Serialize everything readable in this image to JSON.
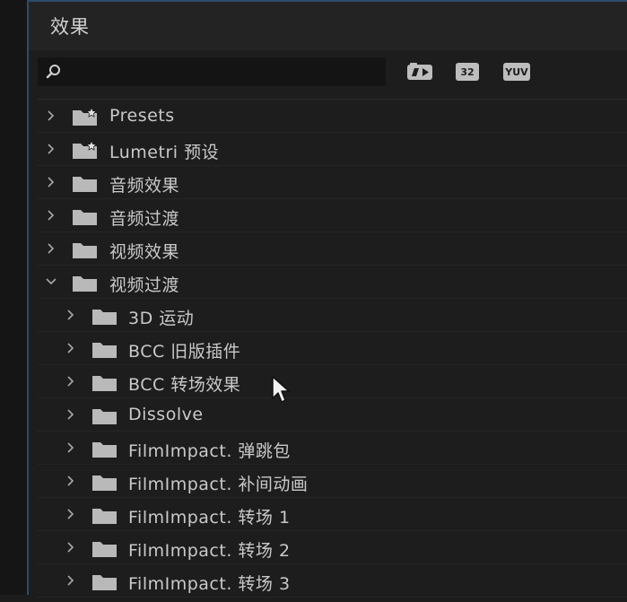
{
  "panel": {
    "title": "效果"
  },
  "search": {
    "value": "",
    "placeholder": ""
  },
  "filters": {
    "yuv_label": "YUV",
    "bit32_label": "32"
  },
  "tree": {
    "items": [
      {
        "label": "Presets",
        "icon": "preset-folder-icon",
        "expanded": false,
        "level": 0
      },
      {
        "label": "Lumetri 预设",
        "icon": "preset-folder-icon",
        "expanded": false,
        "level": 0
      },
      {
        "label": "音频效果",
        "icon": "folder-icon",
        "expanded": false,
        "level": 0
      },
      {
        "label": "音频过渡",
        "icon": "folder-icon",
        "expanded": false,
        "level": 0
      },
      {
        "label": "视频效果",
        "icon": "folder-icon",
        "expanded": false,
        "level": 0
      },
      {
        "label": "视频过渡",
        "icon": "folder-icon",
        "expanded": true,
        "level": 0
      },
      {
        "label": "3D 运动",
        "icon": "folder-icon",
        "expanded": false,
        "level": 1
      },
      {
        "label": "BCC 旧版插件",
        "icon": "folder-icon",
        "expanded": false,
        "level": 1
      },
      {
        "label": "BCC 转场效果",
        "icon": "folder-icon",
        "expanded": false,
        "level": 1
      },
      {
        "label": "Dissolve",
        "icon": "folder-icon",
        "expanded": false,
        "level": 1
      },
      {
        "label": "FilmImpact. 弹跳包",
        "icon": "folder-icon",
        "expanded": false,
        "level": 1
      },
      {
        "label": "FilmImpact. 补间动画",
        "icon": "folder-icon",
        "expanded": false,
        "level": 1
      },
      {
        "label": "FilmImpact. 转场 1",
        "icon": "folder-icon",
        "expanded": false,
        "level": 1
      },
      {
        "label": "FilmImpact. 转场 2",
        "icon": "folder-icon",
        "expanded": false,
        "level": 1
      },
      {
        "label": "FilmImpact. 转场 3",
        "icon": "folder-icon",
        "expanded": false,
        "level": 1
      }
    ]
  },
  "colors": {
    "background": "#1d1d1d",
    "accent_border": "#2f4a6a",
    "text": "#c9c9c9"
  }
}
